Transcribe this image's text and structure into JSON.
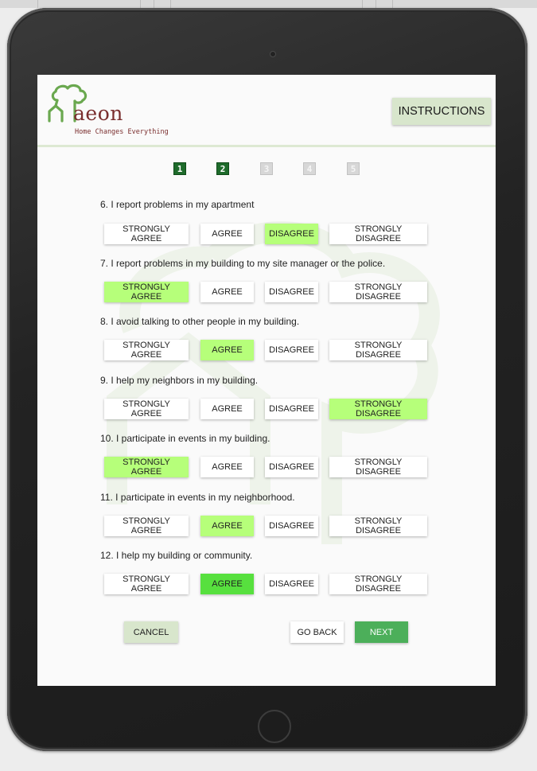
{
  "app": {
    "logo_text": "aeon",
    "tagline": "Home Changes Everything",
    "instructions_label": "INSTRUCTIONS"
  },
  "steps": [
    {
      "label": "1",
      "active": true
    },
    {
      "label": "2",
      "active": true
    },
    {
      "label": "3",
      "active": false
    },
    {
      "label": "4",
      "active": false
    },
    {
      "label": "5",
      "active": false
    }
  ],
  "options": [
    "STRONGLY AGREE",
    "AGREE",
    "DISAGREE",
    "STRONGLY DISAGREE"
  ],
  "questions": [
    {
      "text": "6. I report problems in my apartment",
      "selected": "DISAGREE"
    },
    {
      "text": "7. I report problems in my building to my site manager or the police.",
      "selected": "STRONGLY AGREE"
    },
    {
      "text": "8. I avoid talking to other people in my building.",
      "selected": "AGREE"
    },
    {
      "text": "9. I help my neighbors in my building.",
      "selected": "STRONGLY DISAGREE"
    },
    {
      "text": "10. I participate in events in my building.",
      "selected": "STRONGLY AGREE"
    },
    {
      "text": "11. I participate in events in my neighborhood.",
      "selected": "AGREE"
    },
    {
      "text": "12. I help my building or community.",
      "selected": "AGREE"
    }
  ],
  "buttons": {
    "cancel": "CANCEL",
    "go_back": "GO BACK",
    "next": "NEXT"
  },
  "colors": {
    "brand_green": "#1e6b2b",
    "selected": "#b6ff7a",
    "selected_focus": "#57e03e",
    "next_button": "#4caf5a",
    "logo": "#7a2e2e"
  }
}
